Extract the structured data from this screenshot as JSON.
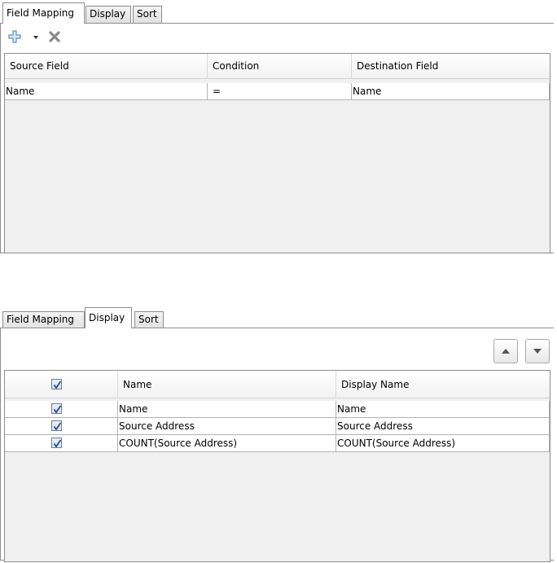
{
  "tabs": {
    "field_mapping": "Field Mapping",
    "display": "Display",
    "sort": "Sort"
  },
  "field_mapping_view": {
    "active_tab": "Field Mapping",
    "toolbar": {
      "add_icon": "plus-icon",
      "dropdown_icon": "chevron-down-icon",
      "delete_icon": "x-icon"
    },
    "columns": [
      "Source Field",
      "Condition",
      "Destination Field"
    ],
    "rows": [
      {
        "source": "Name",
        "condition": "=",
        "destination": "Name"
      }
    ]
  },
  "display_view": {
    "active_tab": "Display",
    "move_up_icon": "arrow-up-icon",
    "move_down_icon": "arrow-down-icon",
    "header_checked": true,
    "columns": [
      "Name",
      "Display Name"
    ],
    "rows": [
      {
        "checked": true,
        "name": "Name",
        "display_name": "Name"
      },
      {
        "checked": true,
        "name": "Source Address",
        "display_name": "Source Address"
      },
      {
        "checked": true,
        "name": "COUNT(Source Address)",
        "display_name": "COUNT(Source Address)"
      }
    ]
  },
  "colors": {
    "border": "#8d8d8d",
    "grid_background": "#f0f0f0",
    "add_icon": "#5b8fc6",
    "delete_icon": "#8a8a8a",
    "check": "#2a4f8c"
  }
}
